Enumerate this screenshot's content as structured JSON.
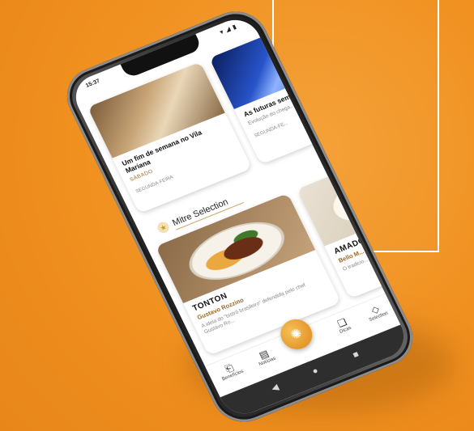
{
  "statusbar": {
    "time": "15:37",
    "icons": "▾ ◢ ▮"
  },
  "news": [
    {
      "title": "Um fim de semana no Vila Mariana",
      "category": "SÁBADO",
      "excerpt": "",
      "date": "SEGUNDA-FEIRA"
    },
    {
      "title": "As futuras sem sequ...",
      "category": "",
      "excerpt": "Evolução do chega...",
      "date": "SEGUNDA-FE..."
    }
  ],
  "section": {
    "title": "Mitre Selection"
  },
  "selection": [
    {
      "name": "TONTON",
      "chef": "Gustavo Rozzino",
      "desc": "A ideia do \"bistrô brasileiro\" defendida pelo chef Gustavo Ro..."
    },
    {
      "name": "AMADO",
      "chef": "Bello M...",
      "desc": "O tradicio... do acer..."
    }
  ],
  "tabs": [
    {
      "label": "Benefícios",
      "icon": "ticket-icon",
      "glyph": "⎗"
    },
    {
      "label": "Notícias",
      "icon": "news-icon",
      "glyph": "▤"
    },
    {
      "label": "",
      "icon": "home-icon",
      "glyph": "✺"
    },
    {
      "label": "Dicas",
      "icon": "tips-icon",
      "glyph": "❏"
    },
    {
      "label": "Selection",
      "icon": "diamond-icon",
      "glyph": "◇"
    }
  ],
  "nav": {
    "back": "◀",
    "home": "●",
    "recent": "■"
  },
  "colors": {
    "background": "#f0901f",
    "accent": "#e4972a",
    "gold": "#c9a66b"
  }
}
